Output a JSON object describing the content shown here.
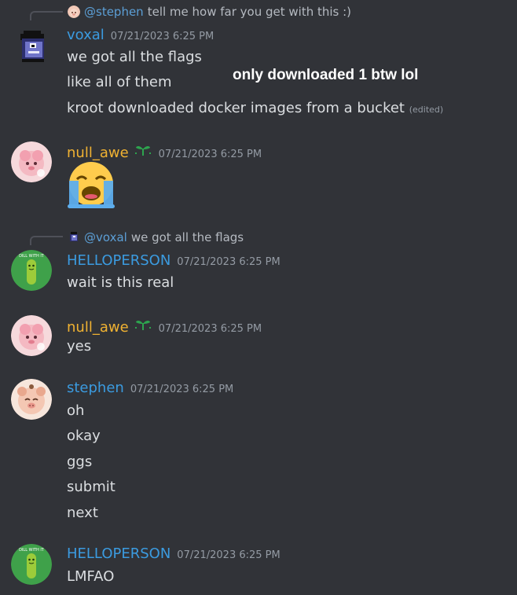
{
  "overlay_note": "only downloaded 1 btw lol",
  "messages": [
    {
      "reply": {
        "mention": "@stephen",
        "text": "tell me how far you get with this :)"
      },
      "username": "voxal",
      "timestamp": "07/21/2023 6:25 PM",
      "lines": [
        "we got all the flags",
        "like all of them",
        "kroot downloaded docker images from a bucket"
      ],
      "edited": "(edited)"
    },
    {
      "username": "null_awe",
      "timestamp": "07/21/2023 6:25 PM",
      "emoji": "loudly-crying-face"
    },
    {
      "reply": {
        "mention": "@voxal",
        "text": "we got all the flags"
      },
      "username": "HELLOPERSON",
      "timestamp": "07/21/2023 6:25 PM",
      "lines": [
        "wait is this real"
      ]
    },
    {
      "username": "null_awe",
      "timestamp": "07/21/2023 6:25 PM",
      "lines": [
        "yes"
      ]
    },
    {
      "username": "stephen",
      "timestamp": "07/21/2023 6:25 PM",
      "lines": [
        "oh",
        "okay",
        "ggs",
        "submit",
        "next"
      ]
    },
    {
      "username": "HELLOPERSON",
      "timestamp": "07/21/2023 6:25 PM",
      "lines": [
        "LMFAO"
      ]
    }
  ],
  "colors": {
    "background": "#313338",
    "voxal": "#3b9be0",
    "null_awe": "#f0b232",
    "helloperson": "#3b9be0",
    "stephen": "#3b9be0",
    "timestamp": "#949ba4"
  }
}
